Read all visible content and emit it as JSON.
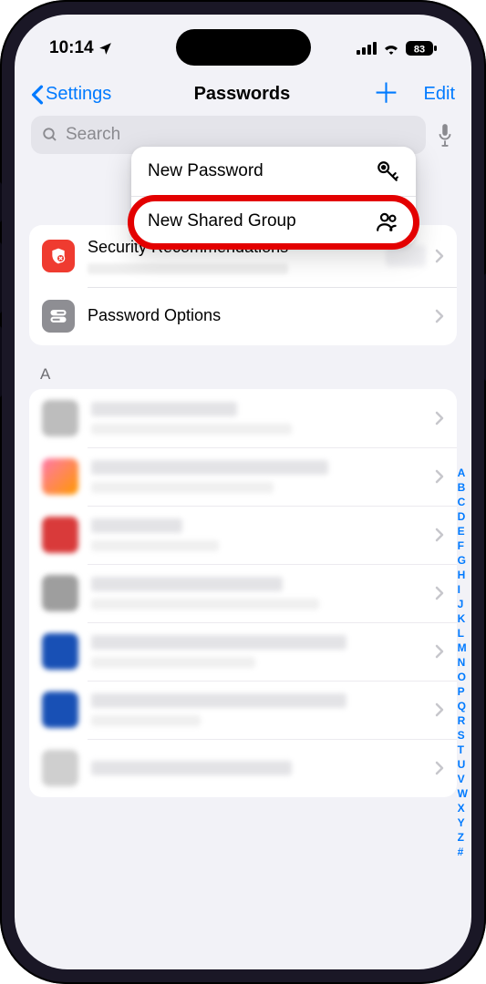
{
  "status": {
    "time": "10:14",
    "battery": "83"
  },
  "nav": {
    "back": "Settings",
    "title": "Passwords",
    "edit": "Edit"
  },
  "search": {
    "placeholder": "Search"
  },
  "popover": {
    "items": [
      {
        "label": "New Password",
        "icon": "key-icon"
      },
      {
        "label": "New Shared Group",
        "icon": "people-icon"
      }
    ]
  },
  "rows": {
    "security": {
      "title": "Security Recommendations"
    },
    "options": {
      "title": "Password Options"
    }
  },
  "section_letter": "A",
  "index_letters": [
    "A",
    "B",
    "C",
    "D",
    "E",
    "F",
    "G",
    "H",
    "I",
    "J",
    "K",
    "L",
    "M",
    "N",
    "O",
    "P",
    "Q",
    "R",
    "S",
    "T",
    "U",
    "V",
    "W",
    "X",
    "Y",
    "Z",
    "#"
  ]
}
